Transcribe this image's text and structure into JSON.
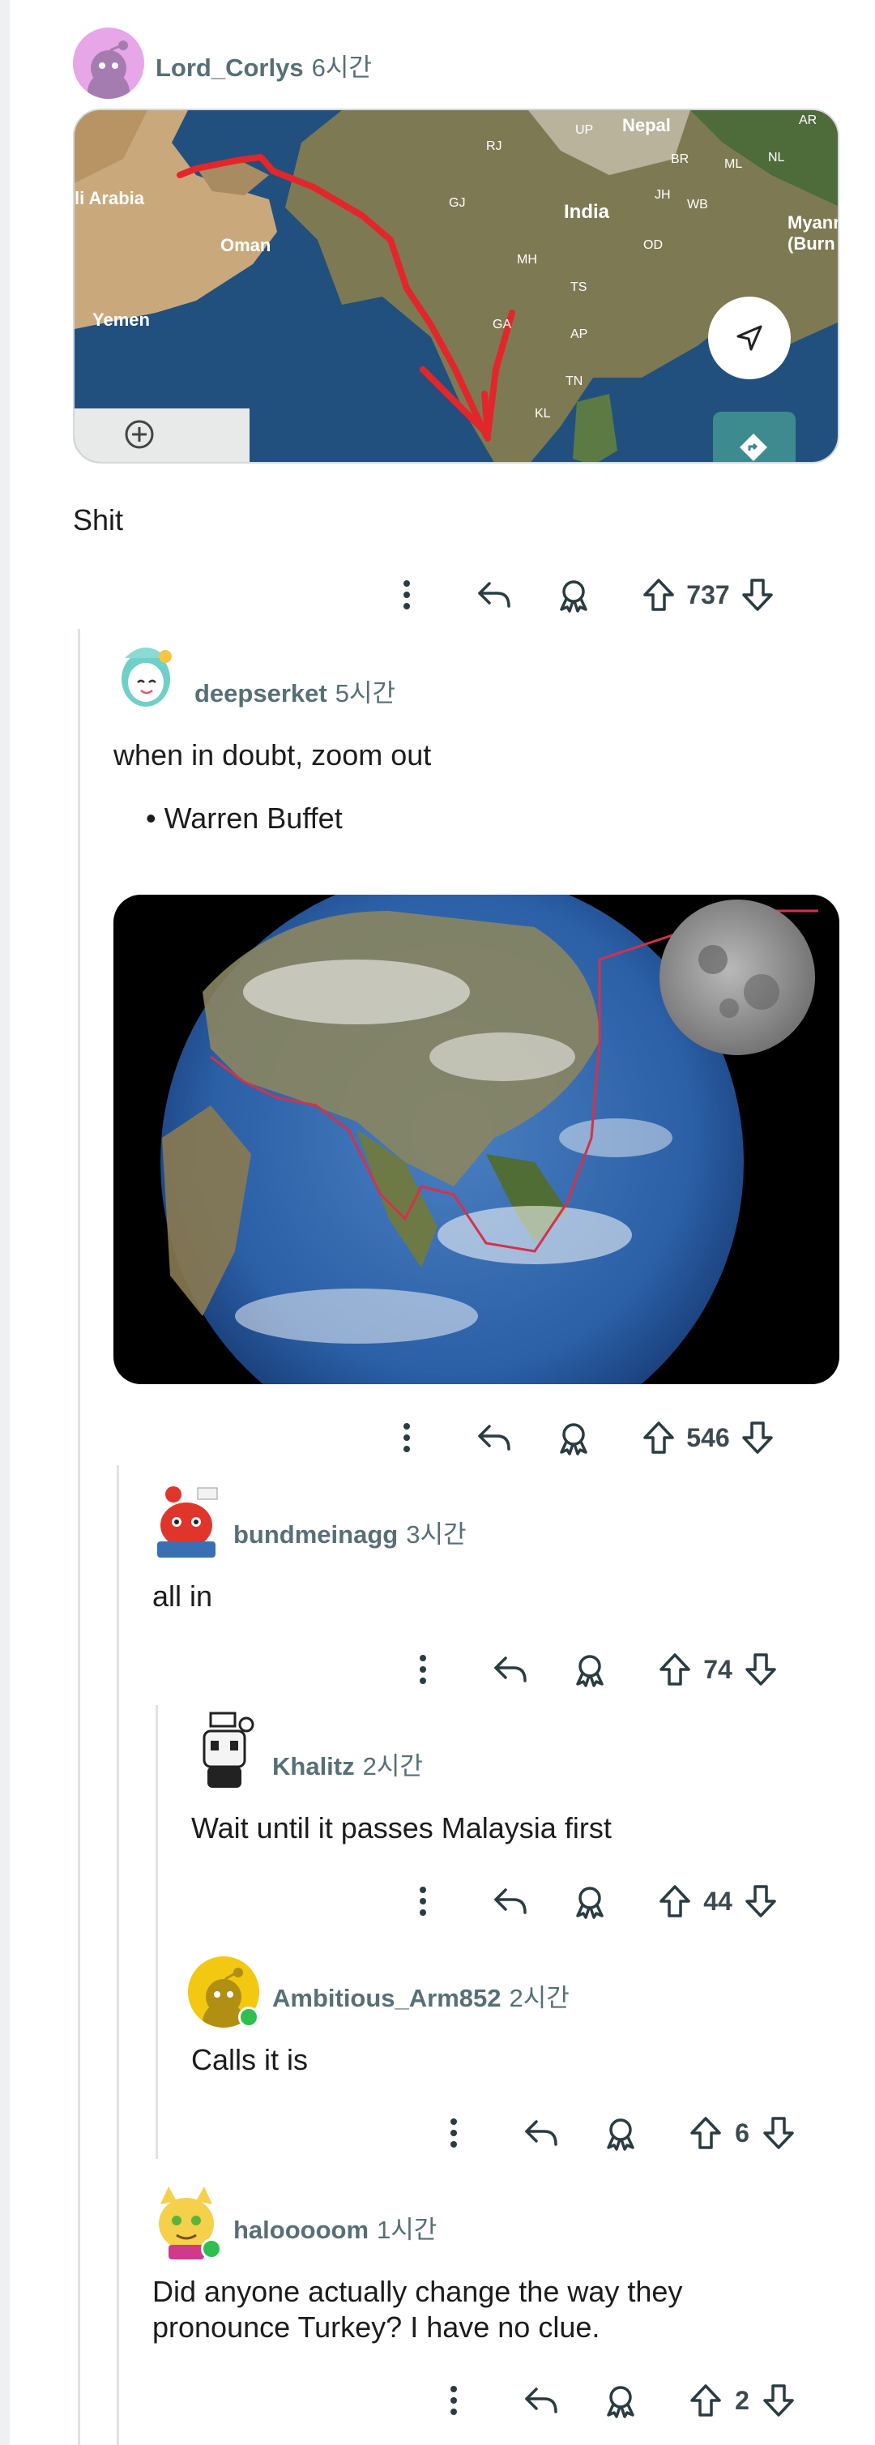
{
  "comments": [
    {
      "username": "Lord_Corlys",
      "time": "6시간",
      "text": "Shit",
      "score": "737",
      "map_labels": {
        "arabia": "li Arabia",
        "oman": "Oman",
        "yemen": "Yemen",
        "nepal": "Nepal",
        "india": "India",
        "myanmar": "Myanr (Burn",
        "up": "UP",
        "rj": "RJ",
        "br": "BR",
        "ml": "ML",
        "nl": "NL",
        "ar": "AR",
        "jh": "JH",
        "wb": "WB",
        "gj": "GJ",
        "mh": "MH",
        "od": "OD",
        "ts": "TS",
        "ap": "AP",
        "ga": "GA",
        "tn": "TN",
        "kl": "KL"
      }
    },
    {
      "username": "deepserket",
      "time": "5시간",
      "text": "when in doubt, zoom out",
      "bullet": "Warren Buffet",
      "score": "546"
    },
    {
      "username": "bundmeinagg",
      "time": "3시간",
      "text": "all in",
      "score": "74"
    },
    {
      "username": "Khalitz",
      "time": "2시간",
      "text": "Wait until it passes Malaysia first",
      "score": "44"
    },
    {
      "username": "Ambitious_Arm852",
      "time": "2시간",
      "text": "Calls it is",
      "score": "6"
    },
    {
      "username": "halooooom",
      "time": "1시간",
      "text": "Did anyone actually change the way they pronounce Turkey? I have no clue.",
      "score": "2"
    }
  ],
  "icons": [
    "more-icon",
    "reply-icon",
    "award-icon",
    "upvote-icon",
    "downvote-icon",
    "navigate-icon",
    "directions-icon",
    "zoom-in-icon"
  ],
  "colors": {
    "username": "#576f76",
    "thread_line": "#dfe3e6",
    "route_red": "#e3262a",
    "online": "#2ec04f"
  }
}
